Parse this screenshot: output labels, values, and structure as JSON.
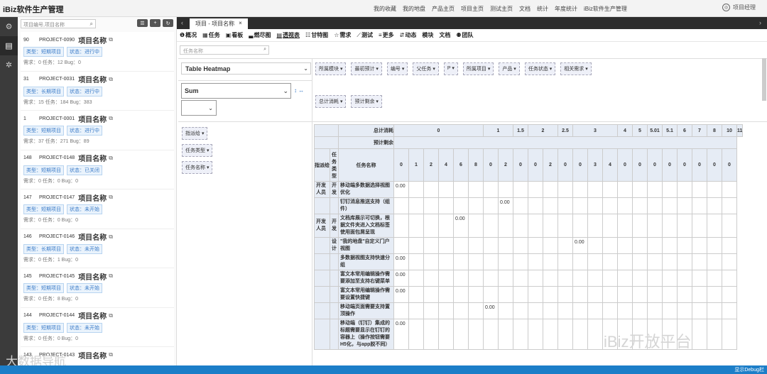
{
  "app": {
    "title": "iBiz软件生产管理",
    "user": "项目经理"
  },
  "topmenu": [
    "我的收藏",
    "我的地盘",
    "产品主页",
    "项目主页",
    "测试主页",
    "文档",
    "统计",
    "年度统计",
    "iBiz软件生产管理"
  ],
  "sidebar": {
    "icons": [
      "module-icon",
      "doc-icon",
      "settings-icon"
    ]
  },
  "projects": {
    "search_placeholder": "项目编号,项目名称",
    "items": [
      {
        "num": "90",
        "code": "PROJECT-0090",
        "name": "项目名称",
        "type": "类型：短期项目",
        "status": "状态：进行中",
        "stats": "需求：0   任务：12   Bug：0"
      },
      {
        "num": "31",
        "code": "PROJECT-0031",
        "name": "项目名称",
        "type": "类型：长期项目",
        "status": "状态：进行中",
        "stats": "需求：15   任务：184   Bug：383"
      },
      {
        "num": "1",
        "code": "PROJECT-0001",
        "name": "项目名称",
        "type": "类型：短期项目",
        "status": "状态：进行中",
        "stats": "需求：37   任务：271   Bug：89"
      },
      {
        "num": "148",
        "code": "PROJECT-0148",
        "name": "项目名称",
        "type": "类型：短期项目",
        "status": "状态：已关闭",
        "stats": "需求：0   任务：0   Bug：0"
      },
      {
        "num": "147",
        "code": "PROJECT-0147",
        "name": "项目名称",
        "type": "类型：短期项目",
        "status": "状态：未开始",
        "stats": "需求：0   任务：0   Bug：0"
      },
      {
        "num": "146",
        "code": "PROJECT-0146",
        "name": "项目名称",
        "type": "类型：长期项目",
        "status": "状态：未开始",
        "stats": "需求：0   任务：1   Bug：0"
      },
      {
        "num": "145",
        "code": "PROJECT-0145",
        "name": "项目名称",
        "type": "类型：短期项目",
        "status": "状态：未开始",
        "stats": "需求：0   任务：8   Bug：0"
      },
      {
        "num": "144",
        "code": "PROJECT-0144",
        "name": "项目名称",
        "type": "类型：短期项目",
        "status": "状态：未开始",
        "stats": "需求：0   任务：0   Bug：0"
      },
      {
        "num": "143",
        "code": "PROJECT-0143",
        "name": "项目名称",
        "type": "",
        "status": "",
        "stats": ""
      }
    ]
  },
  "tab": {
    "label": "项目 - 项目名称"
  },
  "toolbar": [
    "概况",
    "任务",
    "看板",
    "燃尽图",
    "透视表",
    "甘特图",
    "需求",
    "测试",
    "更多",
    "动态",
    "模块",
    "文档",
    "团队"
  ],
  "task_search": {
    "placeholder": "任务名称"
  },
  "pivot": {
    "renderer": "Table Heatmap",
    "aggregator": "Sum",
    "attrs": [
      "所属模块",
      "最初预计",
      "编号",
      "父任务",
      "P",
      "所属项目",
      "产品",
      "任务状态",
      "相关需求"
    ],
    "vals": [
      "总计消耗",
      "预计剩余"
    ],
    "rows": [
      "指派给",
      "任务类型",
      "任务名称"
    ],
    "col_header_consumed": "总计消耗",
    "col_header_left": "预计剩余",
    "row_headers": [
      "指派给",
      "任务类型",
      "任务名称"
    ],
    "consumed_groups": [
      {
        "v": "0",
        "span": 6
      },
      {
        "v": "1",
        "span": 2
      },
      {
        "v": "1.5",
        "span": 1
      },
      {
        "v": "2",
        "span": 2
      },
      {
        "v": "2.5",
        "span": 1
      },
      {
        "v": "3",
        "span": 3
      },
      {
        "v": "4",
        "span": 1
      },
      {
        "v": "5",
        "span": 1
      },
      {
        "v": "5.01",
        "span": 1
      },
      {
        "v": "5.1",
        "span": 1
      },
      {
        "v": "6",
        "span": 1
      },
      {
        "v": "7",
        "span": 1
      },
      {
        "v": "8",
        "span": 1
      },
      {
        "v": "10",
        "span": 1
      },
      {
        "v": "11",
        "span": 1
      }
    ],
    "left_values": [
      "0",
      "1",
      "2",
      "4",
      "6",
      "8",
      "0",
      "2",
      "0",
      "0",
      "2",
      "0",
      "0",
      "3",
      "4",
      "0",
      "0",
      "0",
      "0",
      "0",
      "0",
      "0",
      "0"
    ],
    "body": [
      {
        "who": "开发人员",
        "type": "开发",
        "task": "移动端多数据选择视图优化",
        "col": 0,
        "val": "0.00"
      },
      {
        "who": "",
        "type": "",
        "task": "钉钉消息推送支持（组件）",
        "col": 7,
        "val": "0.00"
      },
      {
        "who": "开发人员",
        "type": "开发",
        "task": "文档库展示可切换，根据文件夹进入文档标签使用面包屑呈现",
        "col": 4,
        "val": "0.00"
      },
      {
        "who": "",
        "type": "设计",
        "task": "\"我的地盘\"自定义门户视图",
        "col": 12,
        "val": "0.00"
      },
      {
        "who": "",
        "type": "",
        "task": "多数据视图支持快速分组",
        "col": 0,
        "val": "0.00"
      },
      {
        "who": "",
        "type": "",
        "task": "富文本常用编辑操作需要添加至支持右键菜单",
        "col": 0,
        "val": "0.00"
      },
      {
        "who": "",
        "type": "",
        "task": "富文本常用编辑操作需要设置快捷键",
        "col": 0,
        "val": "0.00"
      },
      {
        "who": "",
        "type": "",
        "task": "移动端页面需要支持置顶操作",
        "col": 6,
        "val": "0.00"
      },
      {
        "who": "",
        "type": "",
        "task": "移动端（钉钉）集成的标题需要显示在钉钉的容器上（操作按钮需要H5化，与app脱不同）",
        "col": 0,
        "val": "0.00"
      }
    ]
  },
  "statusbar": {
    "debug": "显示Debug栏"
  },
  "watermark": {
    "right": "iBiz开放平台",
    "left": "大数据导航"
  }
}
